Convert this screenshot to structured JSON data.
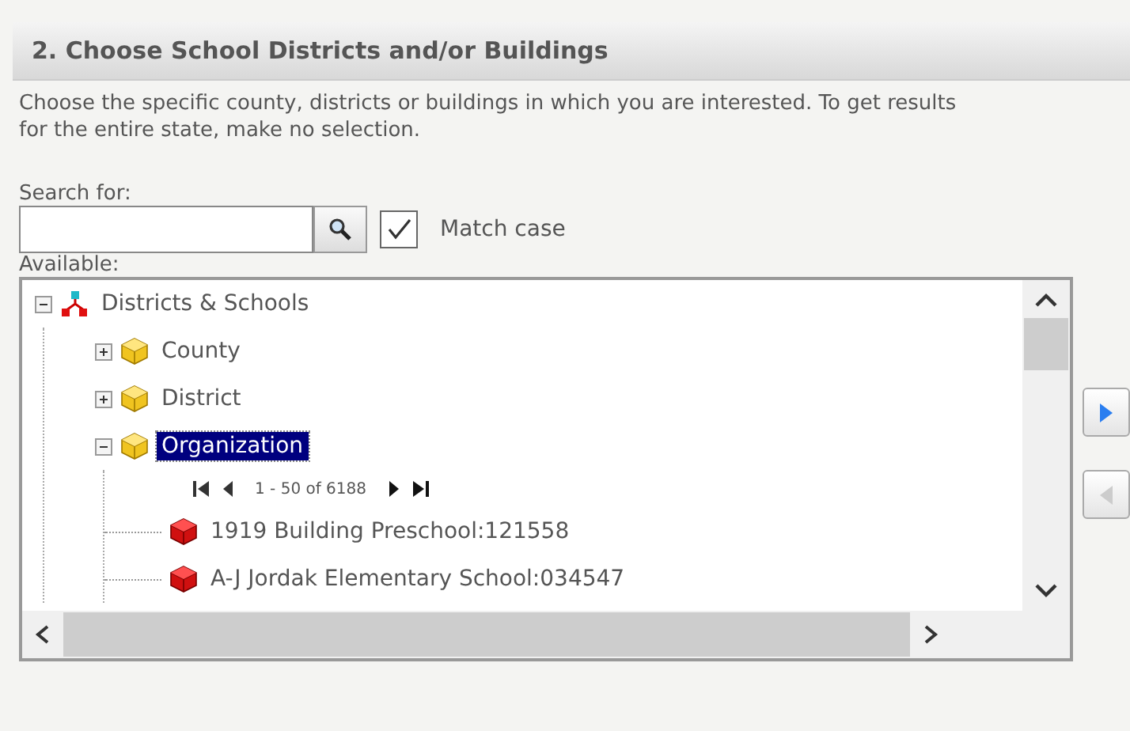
{
  "section": {
    "title": "2. Choose School Districts and/or Buildings",
    "description": "Choose the specific county, districts or buildings in which you are interested. To get results for the entire state, make no selection."
  },
  "search": {
    "label": "Search for:"
  },
  "match_case": {
    "label": "Match case",
    "checked": true
  },
  "available_label": "Available:",
  "tree": {
    "label": "Districts & Schools",
    "expanded": true,
    "selected": false,
    "children": [
      {
        "label": "County",
        "expanded": false,
        "selected": false
      },
      {
        "label": "District",
        "expanded": false,
        "selected": false
      },
      {
        "label": "Organization",
        "expanded": true,
        "selected": true,
        "pager": {
          "range": "1 - 50 of 6188"
        },
        "children": [
          {
            "label": "1919 Building Preschool:121558",
            "selected": false
          },
          {
            "label": "A-J Jordak Elementary School:034547",
            "selected": false
          }
        ]
      }
    ]
  },
  "transfer_buttons": [
    {
      "kind": "add",
      "disabled": false
    },
    {
      "kind": "remove",
      "disabled": true
    }
  ]
}
